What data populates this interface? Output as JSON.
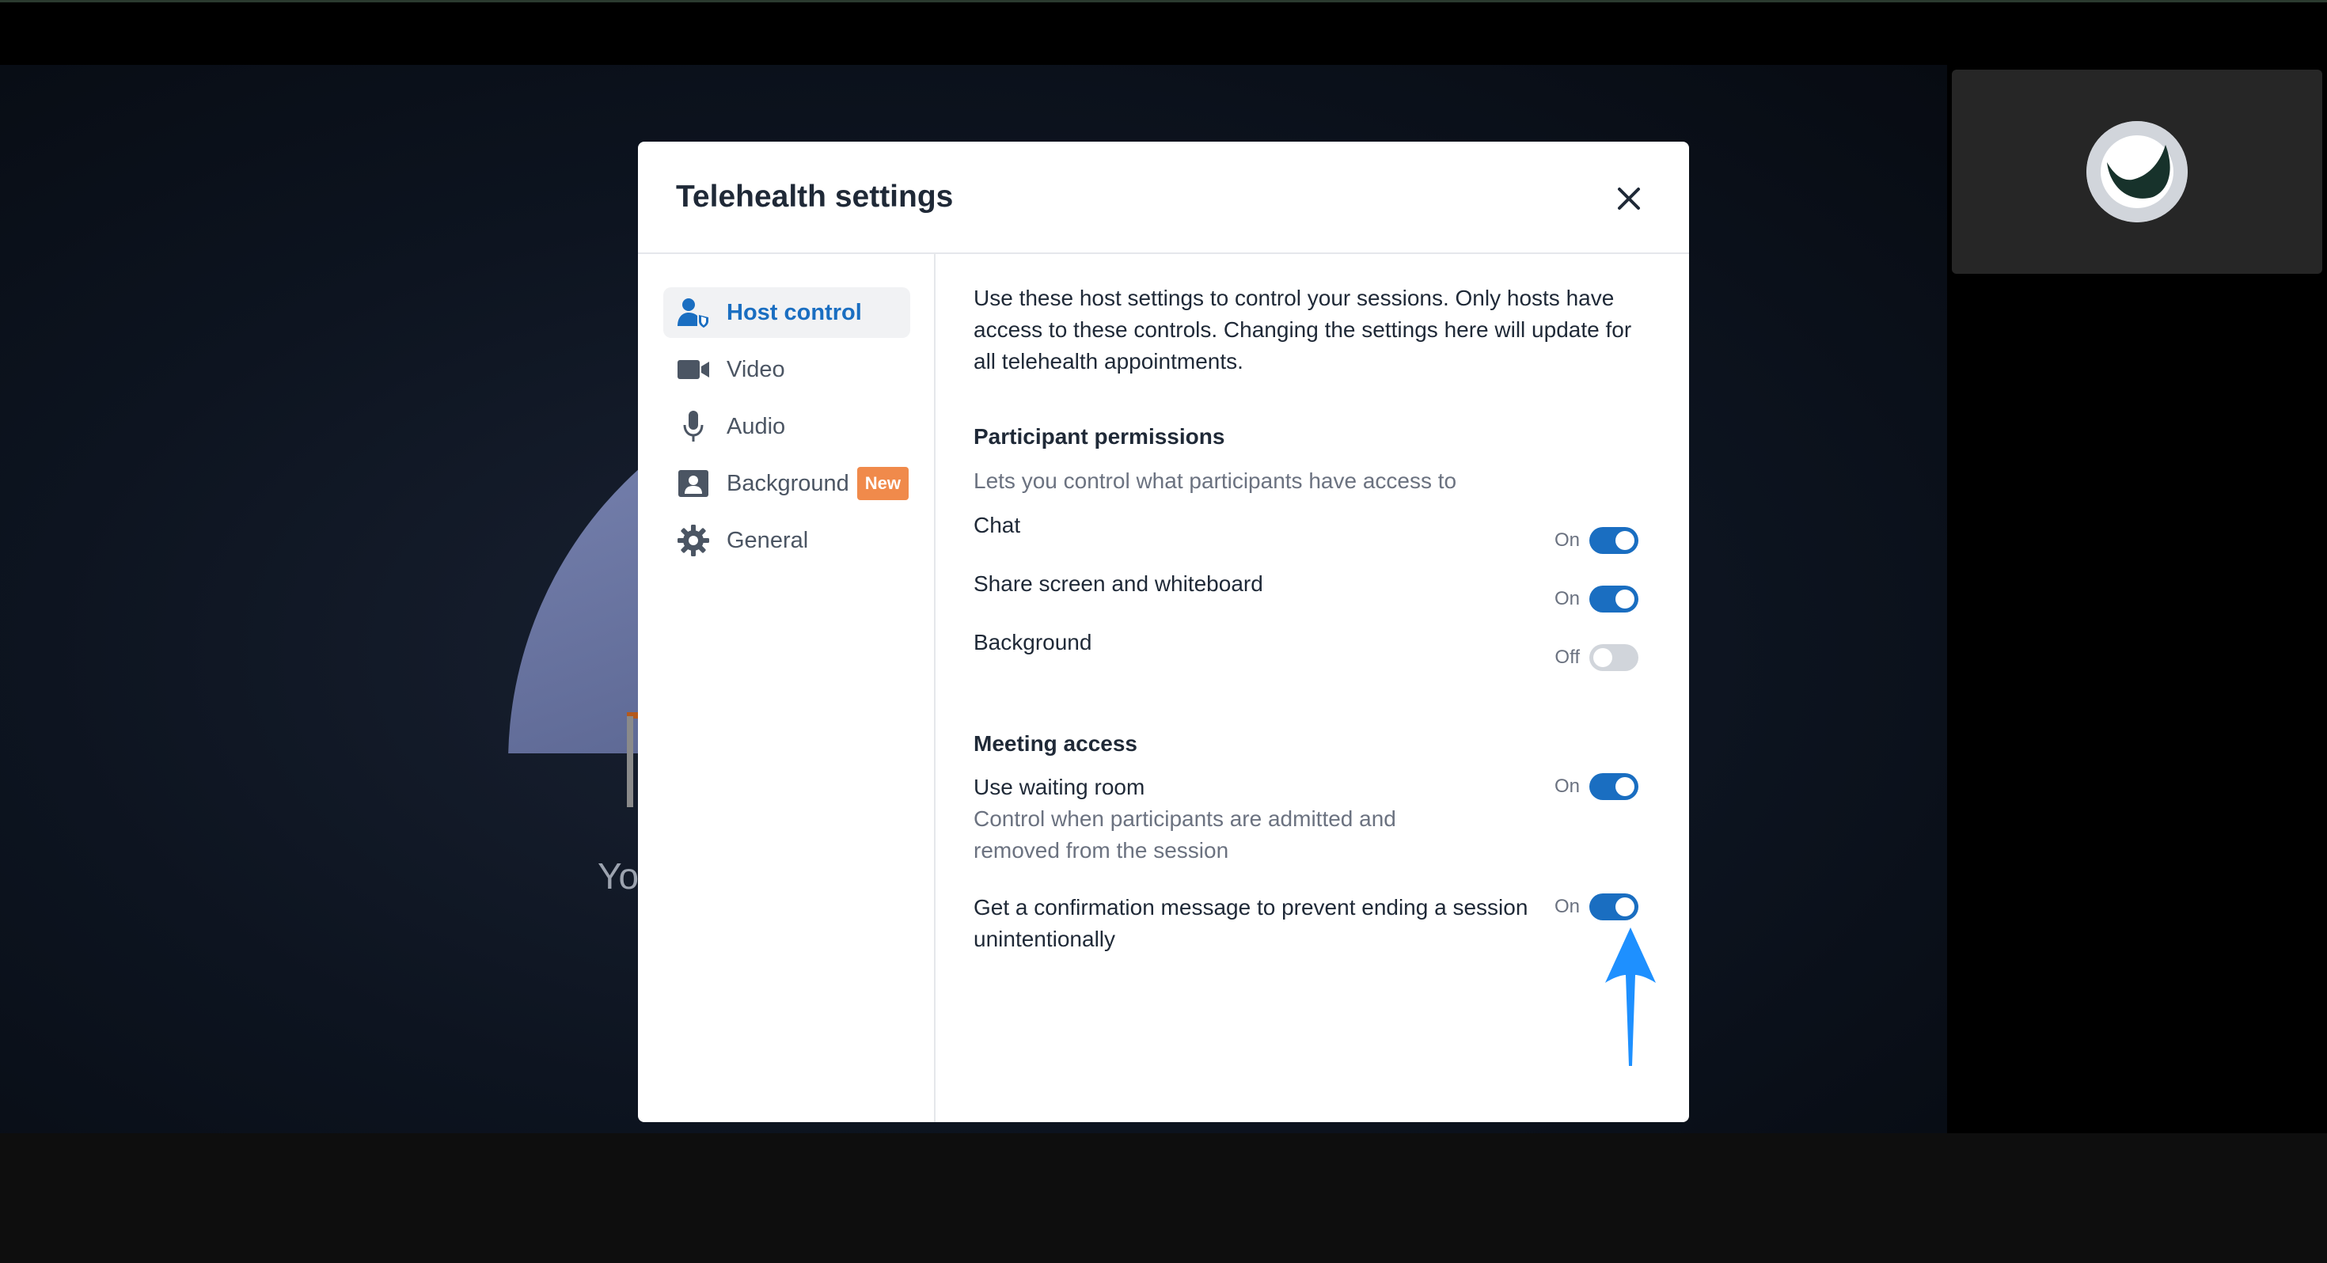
{
  "modal": {
    "title": "Telehealth settings",
    "close_label": "close"
  },
  "sidebar": {
    "items": [
      {
        "label": "Host control",
        "icon": "host-control-icon",
        "active": true
      },
      {
        "label": "Video",
        "icon": "video-camera-icon"
      },
      {
        "label": "Audio",
        "icon": "microphone-icon"
      },
      {
        "label": "Background",
        "icon": "background-icon",
        "badge": "New"
      },
      {
        "label": "General",
        "icon": "gear-icon"
      }
    ]
  },
  "content": {
    "intro": "Use these host settings to control your sessions. Only hosts have access to these controls. Changing the settings here will update for all telehealth appointments.",
    "participant_permissions": {
      "title": "Participant permissions",
      "subtitle": "Lets you control what participants have access to",
      "rows": [
        {
          "label": "Chat",
          "state": "On",
          "enabled": true
        },
        {
          "label": "Share screen and whiteboard",
          "state": "On",
          "enabled": true
        },
        {
          "label": "Background",
          "state": "Off",
          "enabled": false
        }
      ]
    },
    "meeting_access": {
      "title": "Meeting access",
      "rows": [
        {
          "label": "Use waiting room",
          "description": "Control when participants are admitted and removed from the session",
          "state": "On",
          "enabled": true
        },
        {
          "label": "Get a confirmation message to prevent ending a session unintentionally",
          "state": "On",
          "enabled": true
        }
      ]
    }
  },
  "background_video": {
    "partial_text": "Yo"
  },
  "colors": {
    "accent": "#1a6ec1",
    "badge": "#f08a4b",
    "arrow": "#1e90ff"
  }
}
